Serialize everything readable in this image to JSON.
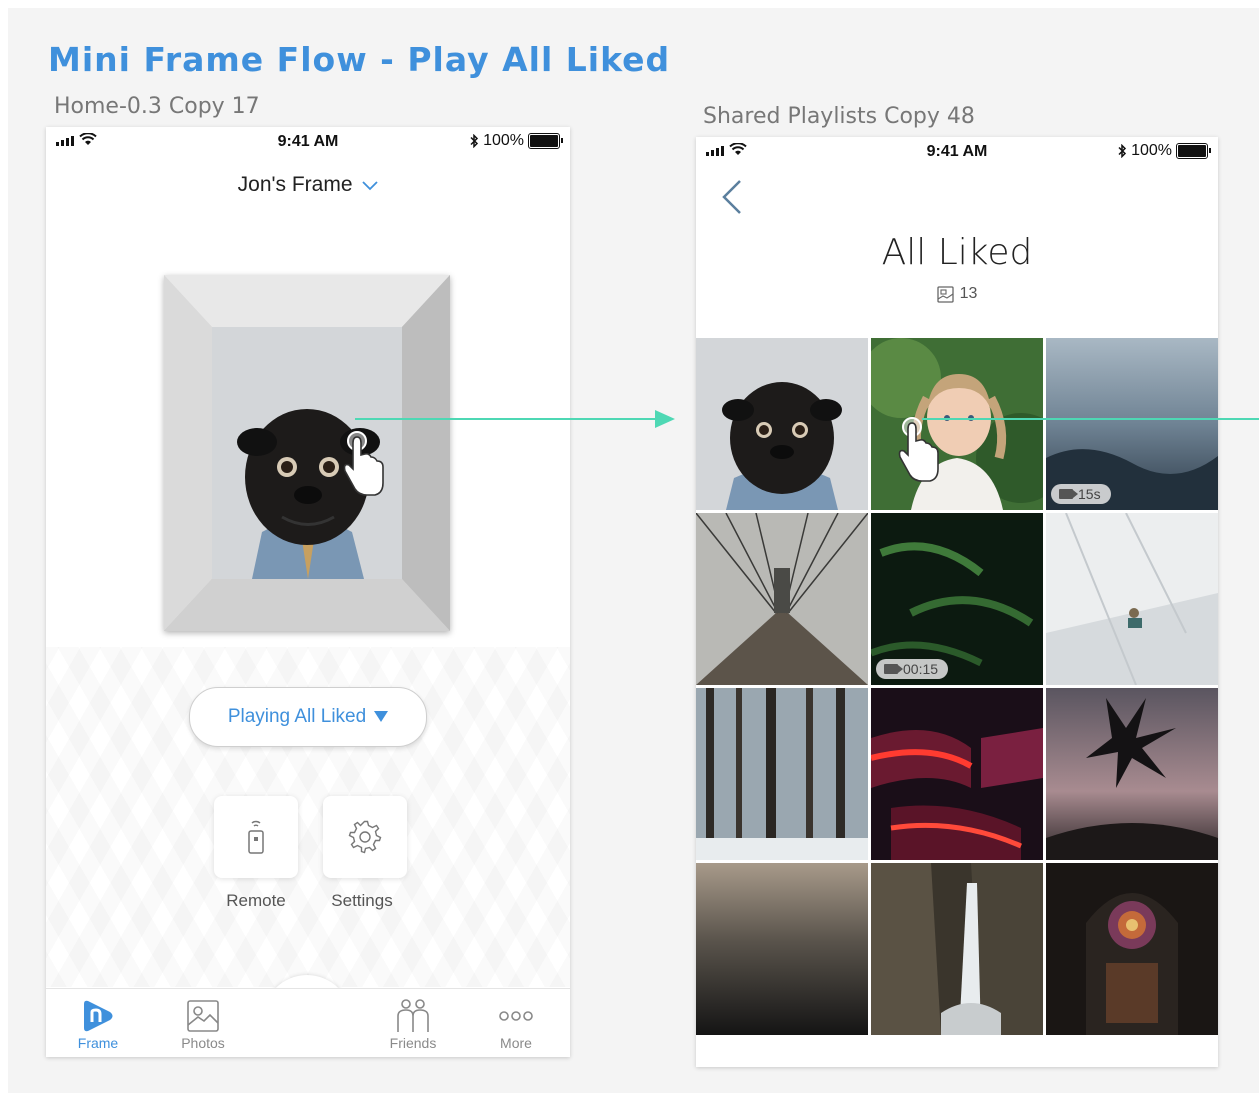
{
  "flow_title": "Mini Frame Flow - Play All Liked",
  "left_artboard": {
    "label": "Home-0.3 Copy 17",
    "status": {
      "time": "9:41 AM",
      "battery": "100%"
    },
    "frame_selector": "Jon's Frame",
    "playing_button": "Playing All Liked",
    "tiles": [
      {
        "label": "Remote",
        "icon": "remote-icon"
      },
      {
        "label": "Settings",
        "icon": "gear-icon"
      }
    ],
    "tabs": [
      {
        "label": "Frame",
        "icon": "frame-logo-icon",
        "active": true
      },
      {
        "label": "Photos",
        "icon": "photos-icon",
        "active": false
      },
      {
        "label": "Friends",
        "icon": "friends-icon",
        "active": false
      },
      {
        "label": "More",
        "icon": "more-dots-icon",
        "active": false
      }
    ]
  },
  "right_artboard": {
    "label": "Shared Playlists Copy 48",
    "status": {
      "time": "9:41 AM",
      "battery": "100%"
    },
    "title": "All Liked",
    "count": "13",
    "grid": [
      {
        "name": "pug",
        "badge": ""
      },
      {
        "name": "girl",
        "badge": ""
      },
      {
        "name": "water-dark",
        "badge": "15s"
      },
      {
        "name": "bridge",
        "badge": ""
      },
      {
        "name": "ferns",
        "badge": "00:15"
      },
      {
        "name": "white-architecture",
        "badge": ""
      },
      {
        "name": "snowy-forest",
        "badge": ""
      },
      {
        "name": "red-tubes",
        "badge": ""
      },
      {
        "name": "leaves-sunset",
        "badge": ""
      },
      {
        "name": "dark-sea",
        "badge": ""
      },
      {
        "name": "waterfall",
        "badge": ""
      },
      {
        "name": "cathedral",
        "badge": ""
      }
    ]
  },
  "colors": {
    "accent": "#3f90dc",
    "arrow": "#4ed8b4"
  }
}
